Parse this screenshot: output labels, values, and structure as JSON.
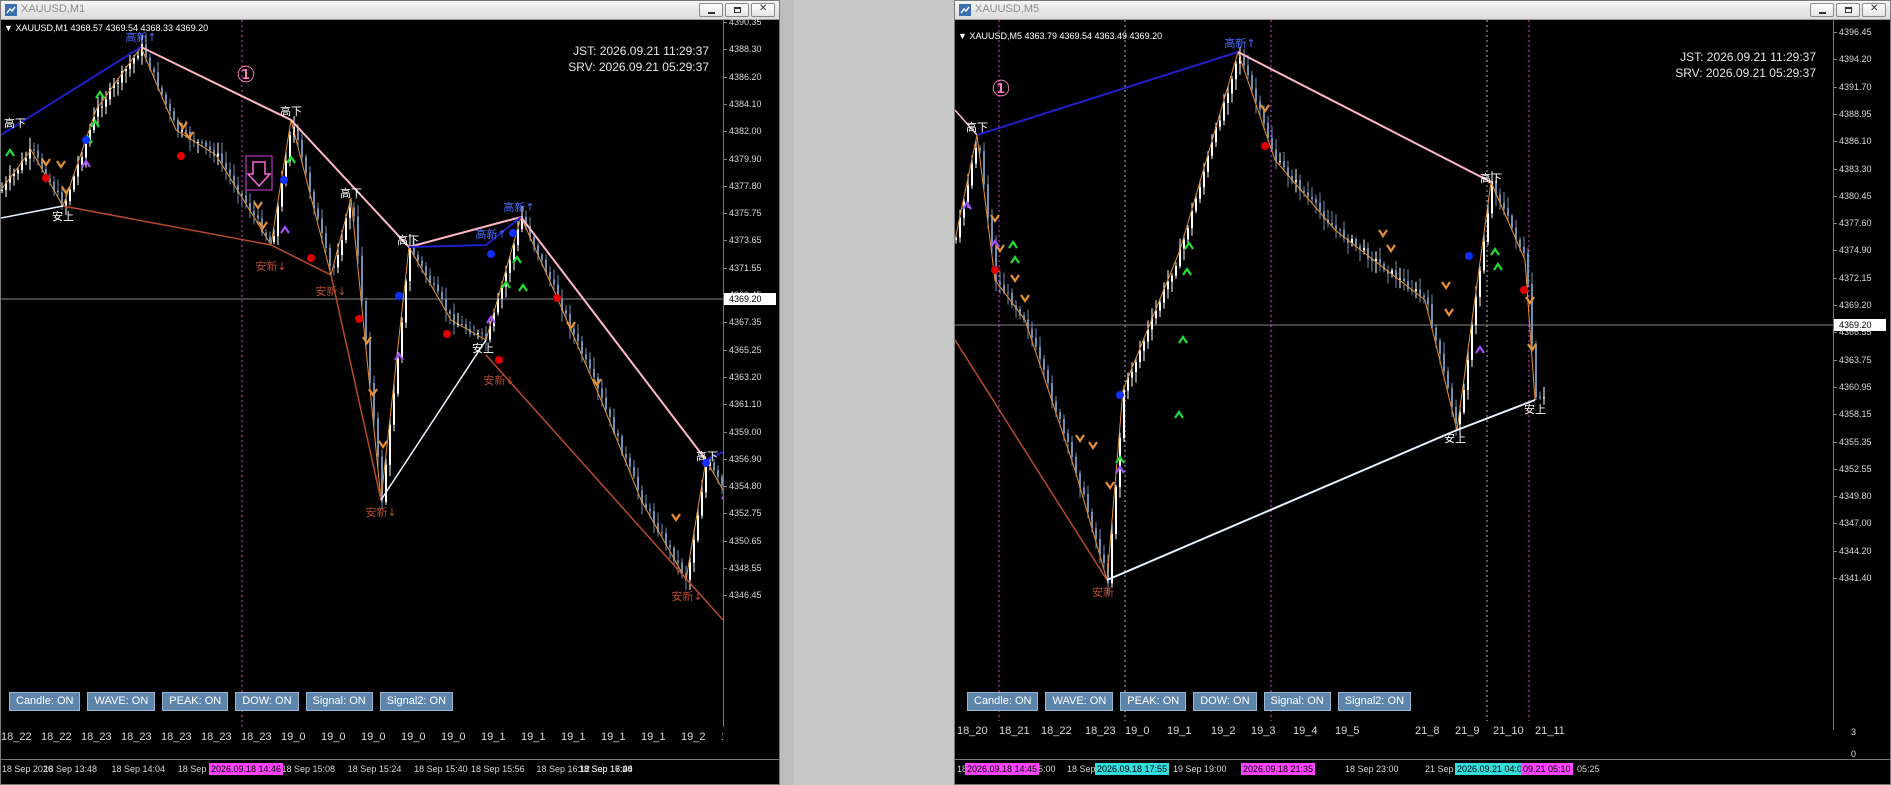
{
  "colors": {
    "up_candle": "#ffffff",
    "down_candle": "#6f8fb3",
    "zigzag": "#e69138",
    "trend_high": "#ffb7c5",
    "trend_low_down": "#b84a2e",
    "trend_low_up": "#e8f4ff",
    "trend_high_break": "#2020c8",
    "marker_magenta": "#e040e0",
    "date_marker_magenta": "#ff44ff",
    "date_marker_cyan": "#33dddd"
  },
  "left": {
    "window_title": "XAUUSD,M1",
    "symbol_info": "XAUUSD,M1  4368.57 4369.54 4368.33 4369.20",
    "jst": "JST: 2026.09.21 11:29:37",
    "srv": "SRV: 2026.09.21 05:29:37",
    "circle_marker": "①",
    "current_price": "4369.20",
    "price_labels": [
      "4390.35",
      "4388.30",
      "4386.20",
      "4384.10",
      "4382.00",
      "4379.90",
      "4377.80",
      "4375.75",
      "4373.65",
      "4371.55",
      "4369.45",
      "4367.35",
      "4365.25",
      "4363.20",
      "4361.10",
      "4359.00",
      "4356.90",
      "4354.80",
      "4352.75",
      "4350.65",
      "4348.55",
      "4346.45"
    ],
    "buttons": [
      "Candle: ON",
      "WAVE: ON",
      "PEAK: ON",
      "DOW: ON",
      "Signal: ON",
      "Signal2: ON"
    ],
    "categories": [
      "18_22",
      "18_22",
      "18_23",
      "18_23",
      "18_23",
      "18_23",
      "18_23",
      "19_0",
      "19_0",
      "19_0",
      "19_0",
      "19_0",
      "19_1",
      "19_1",
      "19_1",
      "19_1",
      "19_1",
      "19_2",
      "19_2"
    ],
    "time_labels": [
      "18 Sep 2026",
      "18 Sep 13:48",
      "18 Sep 14:04",
      "18 Sep 14:20",
      "18 Sep 14:52",
      "18 Sep 15:08",
      "18 Sep 15:24",
      "18 Sep 15:40",
      "18 Sep 15:56",
      "18 Sep 16:12",
      "18 Sep 16:28",
      "18 Sep 16:44",
      "18 Sep 17:00"
    ],
    "time_marker": "2026.09.18 14:46",
    "annotations": {
      "hi_break": "高新↑",
      "hi_down": "高下",
      "lo_up": "安上",
      "lo_break": "安新↓"
    }
  },
  "right": {
    "window_title": "XAUUSD,M5",
    "symbol_info": "XAUUSD,M5  4363.79 4369.54 4363.49 4369.20",
    "jst": "JST: 2026.09.21 11:29:37",
    "srv": "SRV: 2026.09.21 05:29:37",
    "circle_marker": "①",
    "current_price": "4369.20",
    "price_labels": [
      "4396.45",
      "4394.20",
      "4391.70",
      "4388.95",
      "4386.10",
      "4383.30",
      "4380.45",
      "4377.60",
      "4374.90",
      "4372.15",
      "4369.20",
      "4366.55",
      "4363.75",
      "4360.95",
      "4358.15",
      "4355.35",
      "4352.55",
      "4349.80",
      "4347.00",
      "4344.20",
      "4341.40"
    ],
    "buttons": [
      "Candle: ON",
      "WAVE: ON",
      "PEAK: ON",
      "DOW: ON",
      "Signal: ON",
      "Signal2: ON"
    ],
    "categories": [
      "18_20",
      "18_21",
      "18_22",
      "18_23",
      "19_0",
      "19_1",
      "19_2",
      "19_3",
      "19_4",
      "19_5",
      "21_8",
      "21_9",
      "21_10",
      "21_11"
    ],
    "time_labels": [
      "18",
      "15:00",
      "18 Sep 1",
      "19 Sep 19:00",
      "18 S",
      "1:40",
      "18 Sep 23:00",
      "21 Sep 01:25",
      "21 Se",
      "05:25"
    ],
    "time_markers": [
      "2026.09.18 14:45",
      "2026.09.18 17:55",
      "2026.09.18 21:35",
      "2026.09.21 04:05",
      "09.21 05:10"
    ],
    "sub_labels": [
      "3",
      "0"
    ],
    "annotations": {
      "hi_break": "高新↑",
      "hi_down": "高下",
      "lo_up": "安上",
      "lo_break": "安新"
    }
  }
}
